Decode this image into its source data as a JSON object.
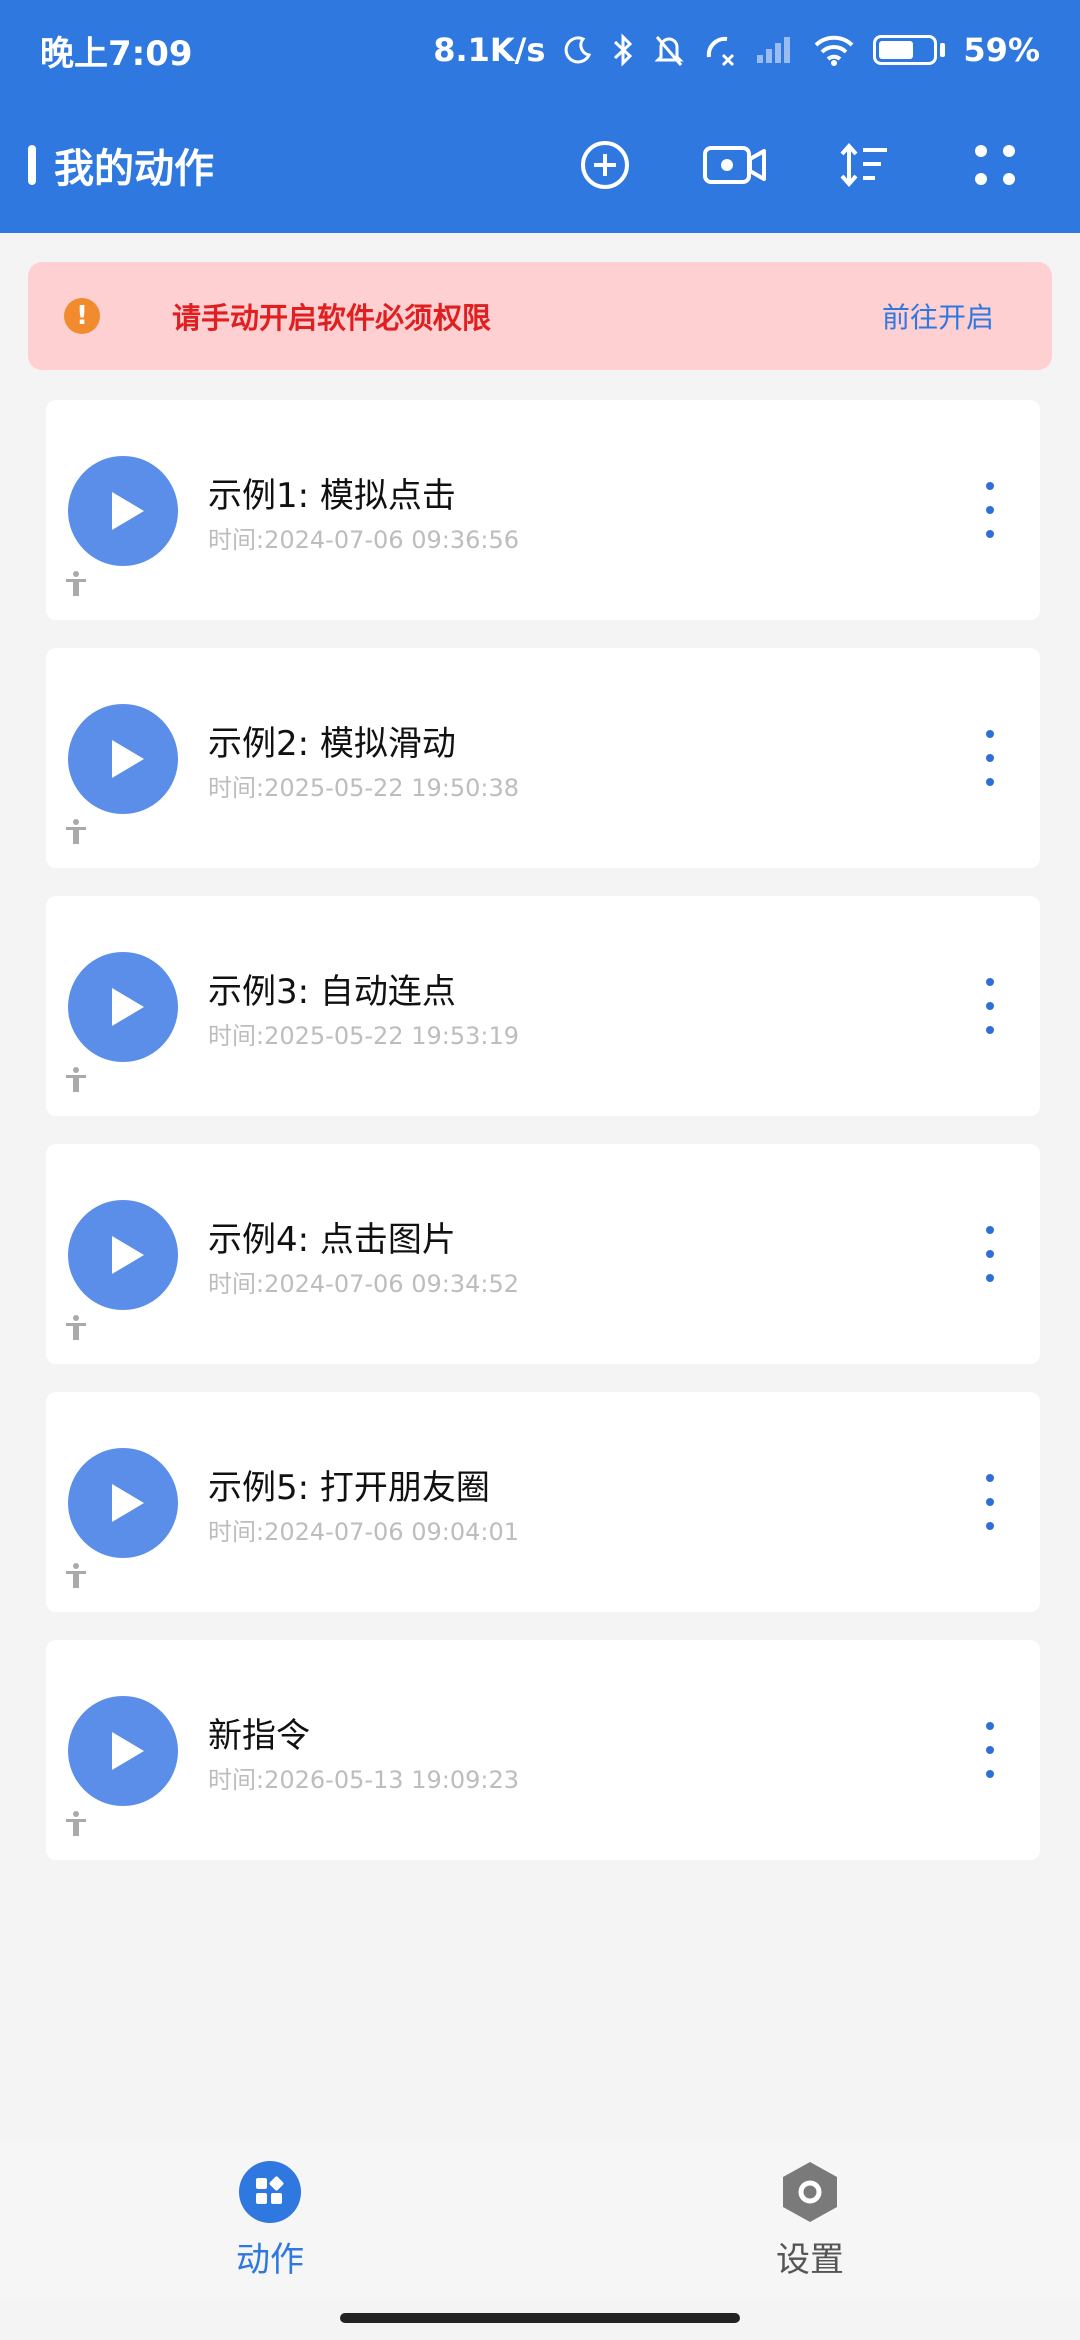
{
  "status": {
    "time": "晚上7:09",
    "net_speed": "8.1K/s",
    "battery": "59%"
  },
  "header": {
    "title": "我的动作",
    "actions": [
      "add-icon",
      "record-video-icon",
      "sort-icon",
      "more-dots-icon"
    ]
  },
  "warning": {
    "text": "请手动开启软件必须权限",
    "link": "前往开启",
    "color": "#ffd0d2"
  },
  "items": [
    {
      "title": "示例1: 模拟点击",
      "time": "时间:2024-07-06 09:36:56"
    },
    {
      "title": "示例2: 模拟滑动",
      "time": "时间:2025-05-22 19:50:38"
    },
    {
      "title": "示例3: 自动连点",
      "time": "时间:2025-05-22 19:53:19"
    },
    {
      "title": "示例4: 点击图片",
      "time": "时间:2024-07-06 09:34:52"
    },
    {
      "title": "示例5: 打开朋友圈",
      "time": "时间:2024-07-06 09:04:01"
    },
    {
      "title": "新指令",
      "time": "时间:2026-05-13 19:09:23"
    }
  ],
  "nav": {
    "actions_label": "动作",
    "settings_label": "设置",
    "active_color": "#2f78e0"
  },
  "accent": "#2f78e0"
}
